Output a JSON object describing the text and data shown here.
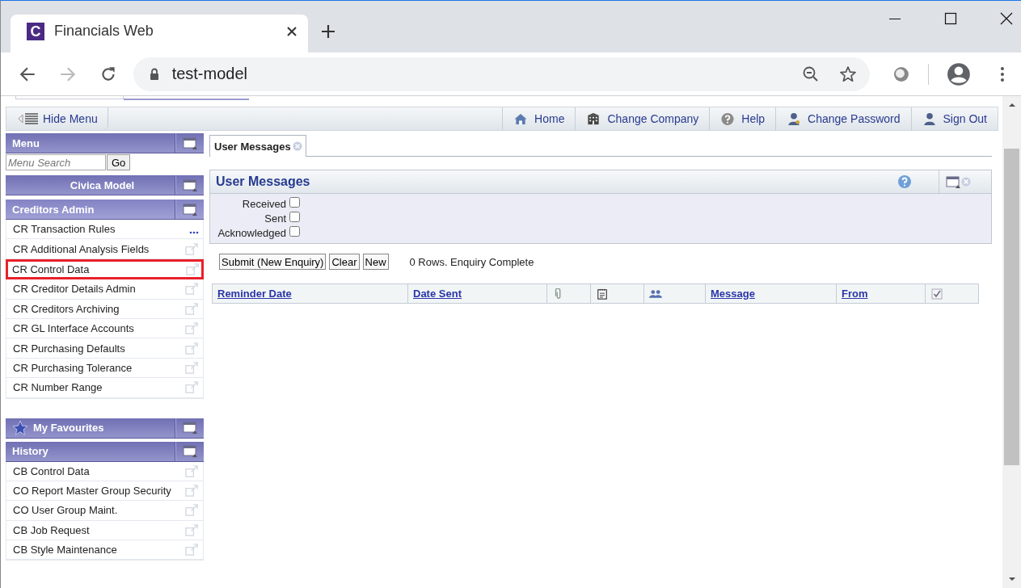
{
  "browser": {
    "favicon_letter": "C",
    "tab_title": "Financials Web",
    "url": "test-model"
  },
  "topbar": {
    "hide_menu": "Hide Menu",
    "links": [
      {
        "kind": "home",
        "label": "Home"
      },
      {
        "kind": "company",
        "label": "Change Company"
      },
      {
        "kind": "help",
        "label": "Help"
      },
      {
        "kind": "password",
        "label": "Change Password"
      },
      {
        "kind": "signout",
        "label": "Sign Out"
      }
    ]
  },
  "sidebar": {
    "menu_title": "Menu",
    "search": {
      "placeholder": "Menu Search",
      "button": "Go"
    },
    "company": "Civica Model",
    "section": {
      "title": "Creditors Admin",
      "items": [
        {
          "label": "CR Transaction Rules",
          "kind": "more",
          "highlighted": false
        },
        {
          "label": "CR Additional Analysis Fields",
          "kind": "popout",
          "highlighted": false
        },
        {
          "label": "CR Control Data",
          "kind": "popout",
          "highlighted": true
        },
        {
          "label": "CR Creditor Details Admin",
          "kind": "popout",
          "highlighted": false
        },
        {
          "label": "CR Creditors Archiving",
          "kind": "popout",
          "highlighted": false
        },
        {
          "label": "CR GL Interface Accounts",
          "kind": "popout",
          "highlighted": false
        },
        {
          "label": "CR Purchasing Defaults",
          "kind": "popout",
          "highlighted": false
        },
        {
          "label": "CR Purchasing Tolerance",
          "kind": "popout",
          "highlighted": false
        },
        {
          "label": "CR Number Range",
          "kind": "popout",
          "highlighted": false
        }
      ]
    },
    "favourites": {
      "title": "My Favourites"
    },
    "history": {
      "title": "History",
      "items": [
        {
          "label": "CB Control Data",
          "kind": "popout",
          "highlighted": false
        },
        {
          "label": "CO Report Master Group Security",
          "kind": "popout",
          "highlighted": false
        },
        {
          "label": "CO User Group Maint.",
          "kind": "popout",
          "highlighted": false
        },
        {
          "label": "CB Job Request",
          "kind": "popout",
          "highlighted": false
        },
        {
          "label": "CB Style Maintenance",
          "kind": "popout",
          "highlighted": false
        }
      ]
    }
  },
  "main": {
    "tabs": [
      {
        "label": "User Messages",
        "selected": true
      }
    ],
    "panel": {
      "title": "User Messages",
      "filters": [
        {
          "label": "Received",
          "checked": false
        },
        {
          "label": "Sent",
          "checked": false
        },
        {
          "label": "Acknowledged",
          "checked": false
        }
      ]
    },
    "buttons": [
      "Submit (New Enquiry)",
      "Clear",
      "New"
    ],
    "status": "0 Rows. Enquiry Complete",
    "table": {
      "columns": [
        {
          "kind": "text",
          "label": "Reminder Date"
        },
        {
          "kind": "text",
          "label": "Date Sent"
        },
        {
          "kind": "attachment"
        },
        {
          "kind": "note"
        },
        {
          "kind": "people"
        },
        {
          "kind": "text",
          "label": "Message"
        },
        {
          "kind": "text",
          "label": "From"
        },
        {
          "kind": "tick"
        }
      ]
    }
  }
}
